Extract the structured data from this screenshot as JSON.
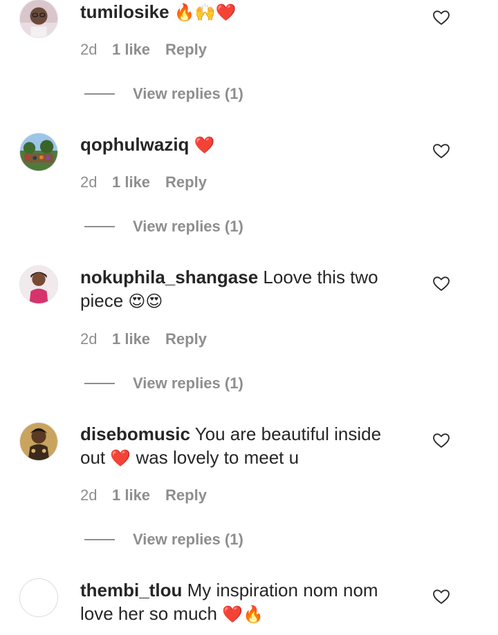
{
  "comments": [
    {
      "username": "tumilosike",
      "text": "",
      "emoji": "🔥🙌❤️",
      "time": "2d",
      "likes": "1 like",
      "reply": "Reply",
      "view_replies": "View replies (1)"
    },
    {
      "username": "qophulwaziq",
      "text": "",
      "emoji": "❤️",
      "time": "2d",
      "likes": "1 like",
      "reply": "Reply",
      "view_replies": "View replies (1)"
    },
    {
      "username": "nokuphila_shangase",
      "text": "Loove this two piece",
      "emoji": "😍😍",
      "time": "2d",
      "likes": "1 like",
      "reply": "Reply",
      "view_replies": "View replies (1)"
    },
    {
      "username": "disebomusic",
      "text": "You are beautiful inside out",
      "emoji": "❤️",
      "text_after": "was lovely to meet u",
      "time": "2d",
      "likes": "1 like",
      "reply": "Reply",
      "view_replies": "View replies (1)"
    },
    {
      "username": "thembi_tlou",
      "text": "My inspiration nom nom love her so much",
      "emoji": "❤️🔥"
    }
  ],
  "colors": {
    "text": "#262626",
    "secondary": "#8e8e8e",
    "heart_emoji": "#e0245e"
  },
  "icons": {
    "like": "heart-outline-icon"
  }
}
